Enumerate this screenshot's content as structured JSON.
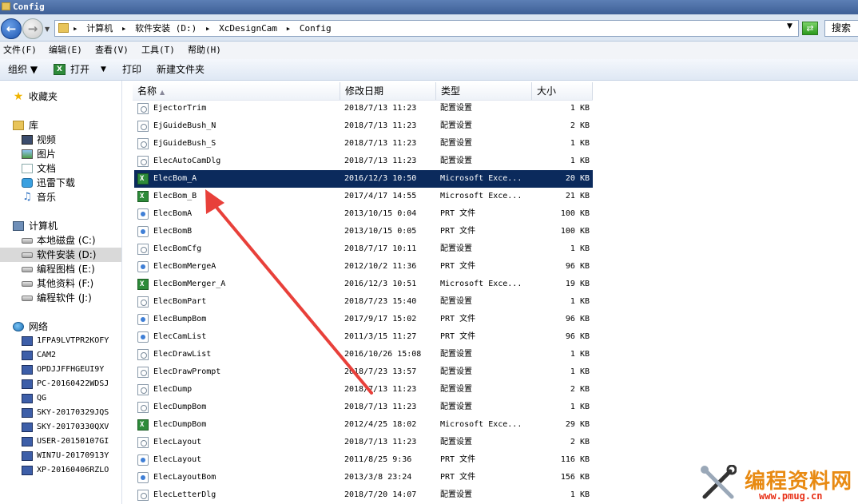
{
  "window": {
    "title": "Config"
  },
  "address": {
    "crumbs": [
      "计算机",
      "软件安装 (D:)",
      "XcDesignCam",
      "Config"
    ],
    "search_placeholder": "搜索"
  },
  "menu": [
    "文件(F)",
    "编辑(E)",
    "查看(V)",
    "工具(T)",
    "帮助(H)"
  ],
  "toolbar": {
    "organize": "组织",
    "open": "打开",
    "print": "打印",
    "new_folder": "新建文件夹"
  },
  "sidebar": {
    "favorites": "收藏夹",
    "libraries": "库",
    "library_items": [
      "视频",
      "图片",
      "文档",
      "迅雷下载",
      "音乐"
    ],
    "computer": "计算机",
    "drives": [
      "本地磁盘 (C:)",
      "软件安装 (D:)",
      "编程图档 (E:)",
      "其他资料 (F:)",
      "编程软件 (J:)"
    ],
    "selected_drive": "软件安装 (D:)",
    "network": "网络",
    "hosts": [
      "1FPA9LVTPR2KOFY",
      "CAM2",
      "OPDJJFFHGEUI9Y",
      "PC-20160422WDSJ",
      "QG",
      "SKY-20170329JQS",
      "SKY-20170330QXV",
      "USER-20150107GI",
      "WIN7U-20170913Y",
      "XP-20160406RZLO"
    ]
  },
  "columns": {
    "name": "名称",
    "date": "修改日期",
    "type": "类型",
    "size": "大小"
  },
  "files": [
    {
      "name": "EjectorTrim",
      "date": "2018/7/13 11:23",
      "type": "配置设置",
      "size": "1 KB",
      "icon": "ini-icon"
    },
    {
      "name": "EjGuideBush_N",
      "date": "2018/7/13 11:23",
      "type": "配置设置",
      "size": "2 KB",
      "icon": "ini-icon"
    },
    {
      "name": "EjGuideBush_S",
      "date": "2018/7/13 11:23",
      "type": "配置设置",
      "size": "1 KB",
      "icon": "ini-icon"
    },
    {
      "name": "ElecAutoCamDlg",
      "date": "2018/7/13 11:23",
      "type": "配置设置",
      "size": "1 KB",
      "icon": "ini-icon"
    },
    {
      "name": "ElecBom_A",
      "date": "2016/12/3 10:50",
      "type": "Microsoft Exce...",
      "size": "20 KB",
      "icon": "excel-icon",
      "selected": true
    },
    {
      "name": "ElecBom_B",
      "date": "2017/4/17 14:55",
      "type": "Microsoft Exce...",
      "size": "21 KB",
      "icon": "excel-icon"
    },
    {
      "name": "ElecBomA",
      "date": "2013/10/15 0:04",
      "type": "PRT 文件",
      "size": "100 KB",
      "icon": "prt-icon"
    },
    {
      "name": "ElecBomB",
      "date": "2013/10/15 0:05",
      "type": "PRT 文件",
      "size": "100 KB",
      "icon": "prt-icon"
    },
    {
      "name": "ElecBomCfg",
      "date": "2018/7/17 10:11",
      "type": "配置设置",
      "size": "1 KB",
      "icon": "ini-icon"
    },
    {
      "name": "ElecBomMergeA",
      "date": "2012/10/2 11:36",
      "type": "PRT 文件",
      "size": "96 KB",
      "icon": "prt-icon"
    },
    {
      "name": "ElecBomMerger_A",
      "date": "2016/12/3 10:51",
      "type": "Microsoft Exce...",
      "size": "19 KB",
      "icon": "excel-icon"
    },
    {
      "name": "ElecBomPart",
      "date": "2018/7/23 15:40",
      "type": "配置设置",
      "size": "1 KB",
      "icon": "ini-icon"
    },
    {
      "name": "ElecBumpBom",
      "date": "2017/9/17 15:02",
      "type": "PRT 文件",
      "size": "96 KB",
      "icon": "prt-icon"
    },
    {
      "name": "ElecCamList",
      "date": "2011/3/15 11:27",
      "type": "PRT 文件",
      "size": "96 KB",
      "icon": "prt-icon"
    },
    {
      "name": "ElecDrawList",
      "date": "2016/10/26 15:08",
      "type": "配置设置",
      "size": "1 KB",
      "icon": "ini-icon"
    },
    {
      "name": "ElecDrawPrompt",
      "date": "2018/7/23 13:57",
      "type": "配置设置",
      "size": "1 KB",
      "icon": "ini-icon"
    },
    {
      "name": "ElecDump",
      "date": "2018/7/13 11:23",
      "type": "配置设置",
      "size": "2 KB",
      "icon": "ini-icon"
    },
    {
      "name": "ElecDumpBom",
      "date": "2018/7/13 11:23",
      "type": "配置设置",
      "size": "1 KB",
      "icon": "ini-icon"
    },
    {
      "name": "ElecDumpBom",
      "date": "2012/4/25 18:02",
      "type": "Microsoft Exce...",
      "size": "29 KB",
      "icon": "excel-icon"
    },
    {
      "name": "ElecLayout",
      "date": "2018/7/13 11:23",
      "type": "配置设置",
      "size": "2 KB",
      "icon": "ini-icon"
    },
    {
      "name": "ElecLayout",
      "date": "2011/8/25 9:36",
      "type": "PRT 文件",
      "size": "116 KB",
      "icon": "prt-icon"
    },
    {
      "name": "ElecLayoutBom",
      "date": "2013/3/8 23:24",
      "type": "PRT 文件",
      "size": "156 KB",
      "icon": "prt-icon"
    },
    {
      "name": "ElecLetterDlg",
      "date": "2018/7/20 14:07",
      "type": "配置设置",
      "size": "1 KB",
      "icon": "ini-icon"
    }
  ],
  "annotation": {
    "arrow_color": "#e8403a"
  },
  "watermark": {
    "title": "编程资料网",
    "url": "www.pmug.cn"
  }
}
